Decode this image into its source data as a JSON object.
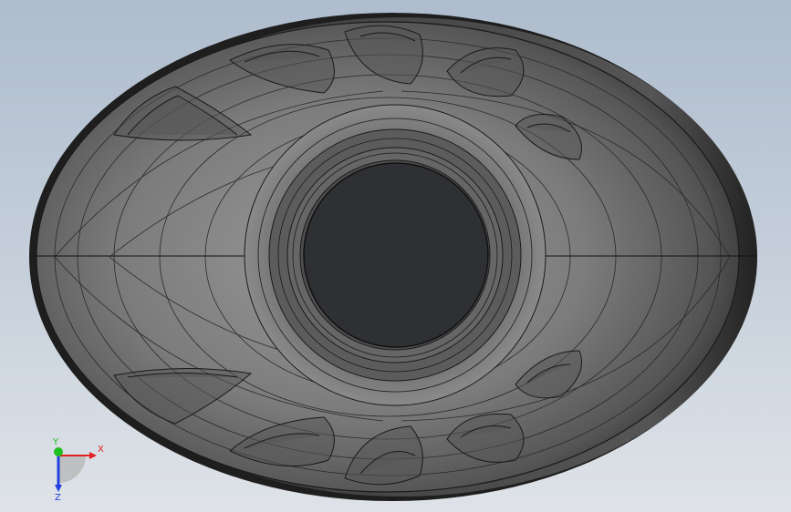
{
  "triad": {
    "x_label": "X",
    "y_label": "Y",
    "z_label": "Z",
    "x_color": "#e02020",
    "y_color": "#20c020",
    "z_color": "#2040e0"
  },
  "model": {
    "icon": "shell-part-model-icon",
    "body_color": "#6e6e6e",
    "hole_color": "#2e3033",
    "edge_color": "#1a1a1a"
  }
}
